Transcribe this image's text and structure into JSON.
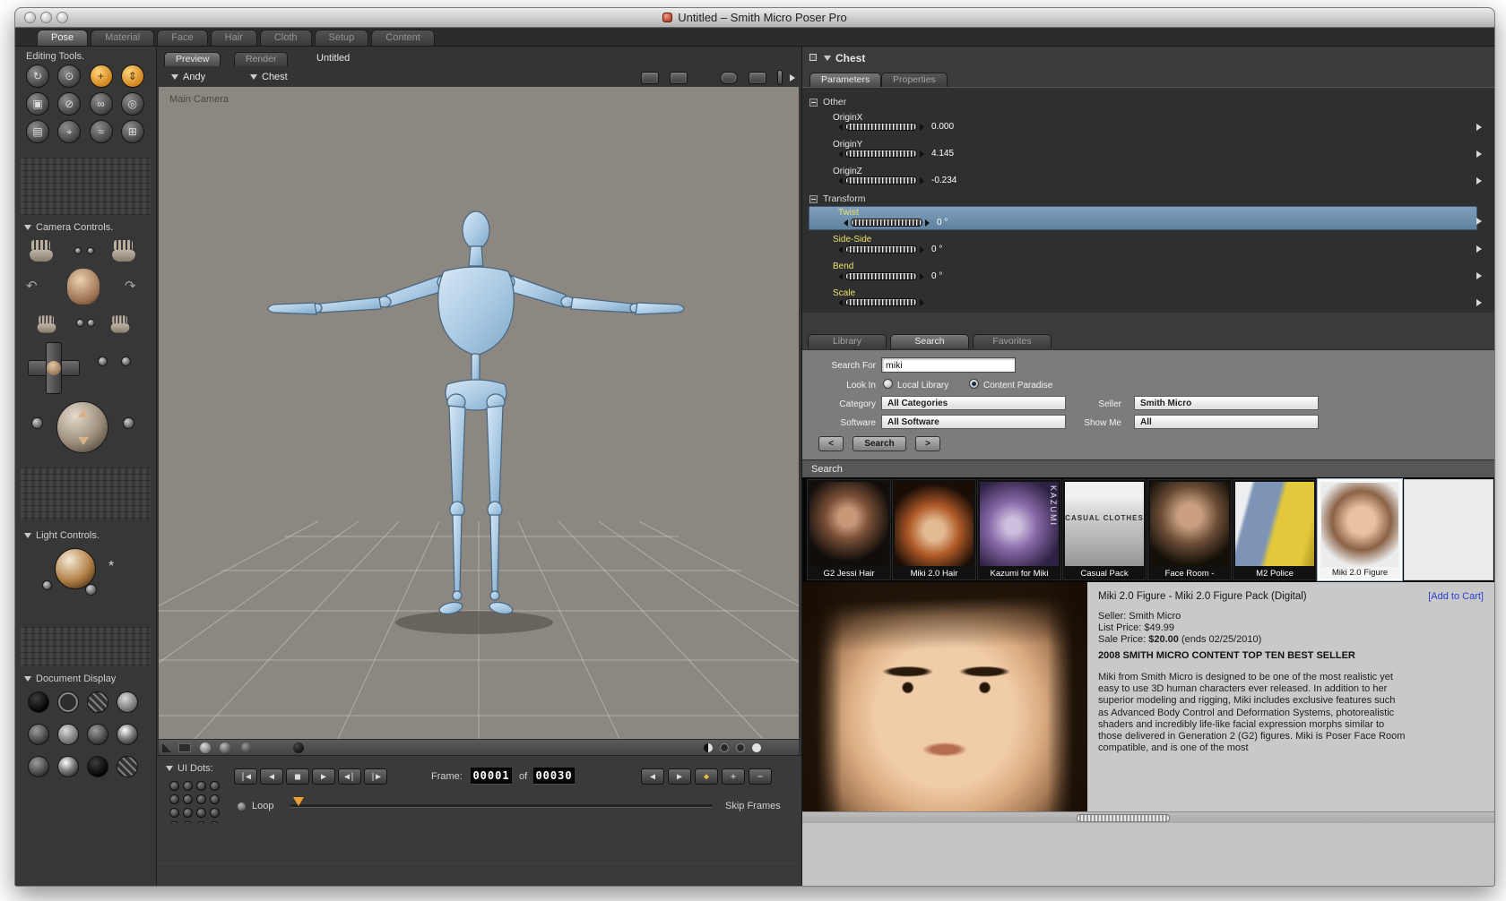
{
  "colors": {
    "accent_orange": "#f0a030",
    "param_highlight_blue": "#6f92b0",
    "param_label_yellow": "#e8e06a",
    "add_to_cart_blue": "#2b3fd4",
    "figure_blue": "#aecbe4"
  },
  "titlebar": {
    "title": "Untitled – Smith Micro Poser Pro"
  },
  "main_tabs": {
    "tabs": [
      {
        "label": "Pose"
      },
      {
        "label": "Material"
      },
      {
        "label": "Face"
      },
      {
        "label": "Hair"
      },
      {
        "label": "Cloth"
      },
      {
        "label": "Setup"
      },
      {
        "label": "Content"
      }
    ]
  },
  "sidebar": {
    "editing_tools_title": "Editing Tools.",
    "camera_controls_title": "Camera Controls.",
    "light_controls_title": "Light Controls.",
    "document_display_title": "Document Display",
    "ui_dots_title": "UI Dots:",
    "tool_glyphs": [
      "↻",
      "⊙",
      "+",
      "⇕",
      "▣",
      "⊘",
      "∞",
      "◎",
      "▤",
      "⌖",
      "≈",
      "⊞"
    ],
    "rotate_left_glyph": "↶",
    "rotate_right_glyph": "↷",
    "sun_glyph": "*"
  },
  "document": {
    "tab_preview": "Preview",
    "tab_render": "Render",
    "title": "Untitled",
    "figure_menu": "Andy",
    "actor_menu": "Chest",
    "camera_label": "Main Camera"
  },
  "playback": {
    "frame_label": "Frame:",
    "frame_current": "00001",
    "of_label": "of",
    "frame_total": "00030",
    "loop_label": "Loop",
    "skip_frames_label": "Skip Frames",
    "transport": [
      "|◀",
      "◀",
      "■",
      "▶",
      "◀|",
      "|▶"
    ],
    "edit_buttons": [
      "◀",
      "▶",
      "◆",
      "+",
      "−"
    ]
  },
  "parameters": {
    "title": "Chest",
    "tab_parameters": "Parameters",
    "tab_properties": "Properties",
    "group_other": "Other",
    "group_transform": "Transform",
    "params": [
      {
        "label": "OriginX",
        "value": "0.000"
      },
      {
        "label": "OriginY",
        "value": "4.145"
      },
      {
        "label": "OriginZ",
        "value": "-0.234"
      },
      {
        "label": "Twist",
        "value": "0 °"
      },
      {
        "label": "Side-Side",
        "value": "0 °"
      },
      {
        "label": "Bend",
        "value": "0 °"
      },
      {
        "label": "Scale",
        "value": ""
      }
    ]
  },
  "library": {
    "tab_library": "Library",
    "tab_search": "Search",
    "tab_favorites": "Favorites",
    "search_for_label": "Search For",
    "search_value": "miki",
    "look_in_label": "Look In",
    "local_library_label": "Local Library",
    "content_paradise_label": "Content Paradise",
    "category_label": "Category",
    "category_value": "All Categories",
    "seller_label": "Seller",
    "seller_value": "Smith Micro",
    "software_label": "Software",
    "software_value": "All Software",
    "show_me_label": "Show Me",
    "show_me_value": "All",
    "prev_button": "<",
    "search_button": "Search",
    "next_button": ">",
    "results_header": "Search",
    "results": [
      {
        "label": "G2 Jessi Hair"
      },
      {
        "label": "Miki 2.0 Hair"
      },
      {
        "label": "Kazumi for Miki",
        "overlay": "KAZUMI"
      },
      {
        "label": "Casual Pack",
        "overlay": "CASUAL CLOTHES"
      },
      {
        "label": "Face Room -"
      },
      {
        "label": "M2 Police"
      },
      {
        "label": "Miki 2.0 Figure"
      }
    ]
  },
  "product": {
    "title": "Miki 2.0 Figure - Miki 2.0 Figure Pack (Digital)",
    "add_to_cart": "[Add to Cart]",
    "seller_line": "Seller: Smith Micro",
    "list_price_line": "List Price: $49.99",
    "sale_price_label": "Sale Price: ",
    "sale_price_value": "$20.00",
    "sale_price_suffix": " (ends 02/25/2010)",
    "banner": "2008 SMITH MICRO CONTENT TOP TEN BEST SELLER",
    "description": "Miki from Smith Micro is designed to be one of the most realistic yet easy to use 3D human characters ever released. In addition to her superior modeling and rigging, Miki includes exclusive features such as Advanced Body Control and Deformation Systems, photorealistic shaders and incredibly life-like facial expression morphs similar to those delivered in Generation 2 (G2) figures. Miki is Poser Face Room compatible, and is one of the most"
  }
}
